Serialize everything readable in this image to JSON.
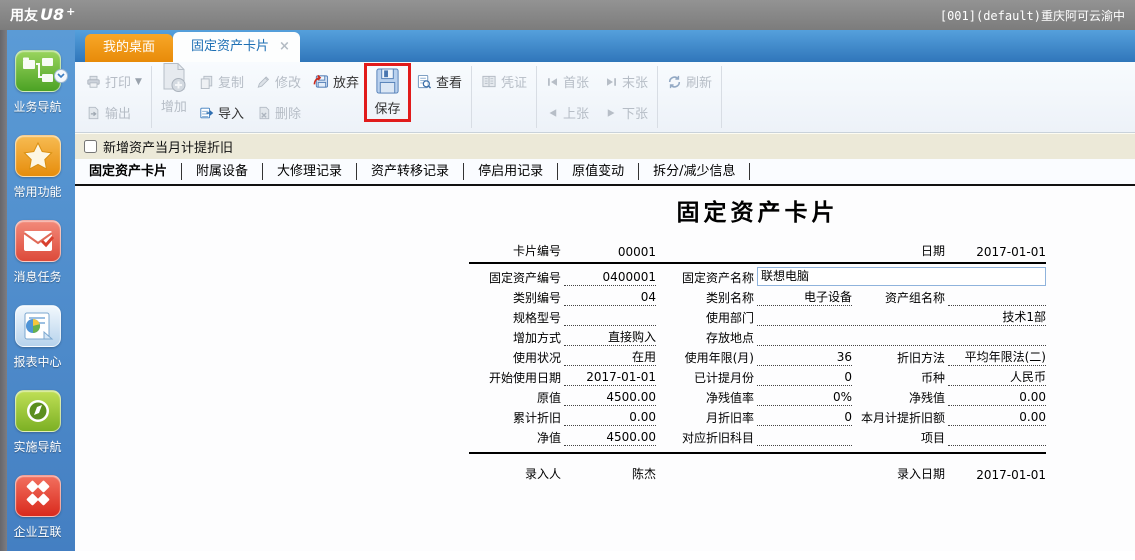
{
  "titlebar": {
    "brand": "用友",
    "brand_sub": "U8",
    "brand_plus": "+",
    "user_info": "[001](default)重庆阿可云渝中"
  },
  "tabs": [
    {
      "label": "我的桌面"
    },
    {
      "label": "固定资产卡片",
      "close": "×"
    }
  ],
  "toolbar": {
    "print": "打印",
    "export": "输出",
    "add": "增加",
    "copy": "复制",
    "import": "导入",
    "modify": "修改",
    "delete": "删除",
    "discard": "放弃",
    "save": "保存",
    "view": "查看",
    "voucher": "凭证",
    "first": "首张",
    "last": "末张",
    "prev": "上张",
    "next": "下张",
    "refresh": "刷新"
  },
  "checkbox": {
    "label": "新增资产当月计提折旧",
    "checked": false
  },
  "subtabs": [
    "固定资产卡片",
    "附属设备",
    "大修理记录",
    "资产转移记录",
    "停启用记录",
    "原值变动",
    "拆分/减少信息"
  ],
  "sidebar": {
    "items": [
      {
        "label": "业务导航",
        "icon": "nav-tree-icon"
      },
      {
        "label": "常用功能",
        "icon": "star-icon"
      },
      {
        "label": "消息任务",
        "icon": "message-icon"
      },
      {
        "label": "报表中心",
        "icon": "report-icon"
      },
      {
        "label": "实施导航",
        "icon": "compass-icon"
      },
      {
        "label": "企业互联",
        "icon": "link-icon"
      }
    ]
  },
  "form": {
    "title": "固定资产卡片",
    "header": {
      "card_no_label": "卡片编号",
      "card_no": "00001",
      "date_label": "日期",
      "date": "2017-01-01"
    },
    "rows": [
      [
        {
          "l": "固定资产编号",
          "v": "0400001",
          "c": "a"
        },
        {
          "l": "固定资产名称",
          "v": "联想电脑",
          "c": "input"
        }
      ],
      [
        {
          "l": "类别编号",
          "v": "04",
          "c": "a"
        },
        {
          "l": "类别名称",
          "v": "电子设备",
          "c": "b"
        },
        {
          "l": "资产组名称",
          "v": "",
          "c": "c"
        }
      ],
      [
        {
          "l": "规格型号",
          "v": "",
          "c": "a"
        },
        {
          "l": "使用部门",
          "v": "技术1部",
          "c": "wide"
        }
      ],
      [
        {
          "l": "增加方式",
          "v": "直接购入",
          "c": "a"
        },
        {
          "l": "存放地点",
          "v": "",
          "c": "wide"
        }
      ],
      [
        {
          "l": "使用状况",
          "v": "在用",
          "c": "a"
        },
        {
          "l": "使用年限(月)",
          "v": "36",
          "c": "b"
        },
        {
          "l": "折旧方法",
          "v": "平均年限法(二)",
          "c": "c"
        }
      ],
      [
        {
          "l": "开始使用日期",
          "v": "2017-01-01",
          "c": "a"
        },
        {
          "l": "已计提月份",
          "v": "0",
          "c": "b"
        },
        {
          "l": "币种",
          "v": "人民币",
          "c": "c"
        }
      ],
      [
        {
          "l": "原值",
          "v": "4500.00",
          "c": "a"
        },
        {
          "l": "净残值率",
          "v": "0%",
          "c": "b"
        },
        {
          "l": "净残值",
          "v": "0.00",
          "c": "c"
        }
      ],
      [
        {
          "l": "累计折旧",
          "v": "0.00",
          "c": "a"
        },
        {
          "l": "月折旧率",
          "v": "0",
          "c": "b"
        },
        {
          "l": "本月计提折旧额",
          "v": "0.00",
          "c": "c"
        }
      ],
      [
        {
          "l": "净值",
          "v": "4500.00",
          "c": "a"
        },
        {
          "l": "对应折旧科目",
          "v": "",
          "c": "b"
        },
        {
          "l": "项目",
          "v": "",
          "c": "c"
        }
      ]
    ],
    "footer": {
      "entered_by_label": "录入人",
      "entered_by": "陈杰",
      "entry_date_label": "录入日期",
      "entry_date": "2017-01-01"
    }
  },
  "colors": {
    "highlight_box": "#e11b1b",
    "tabbar_blue": "#3f8ccc",
    "home_tab_orange": "#f09313",
    "sidebar_blue": "#4a86c8",
    "checkbox_row_beige": "#ece9d8"
  }
}
